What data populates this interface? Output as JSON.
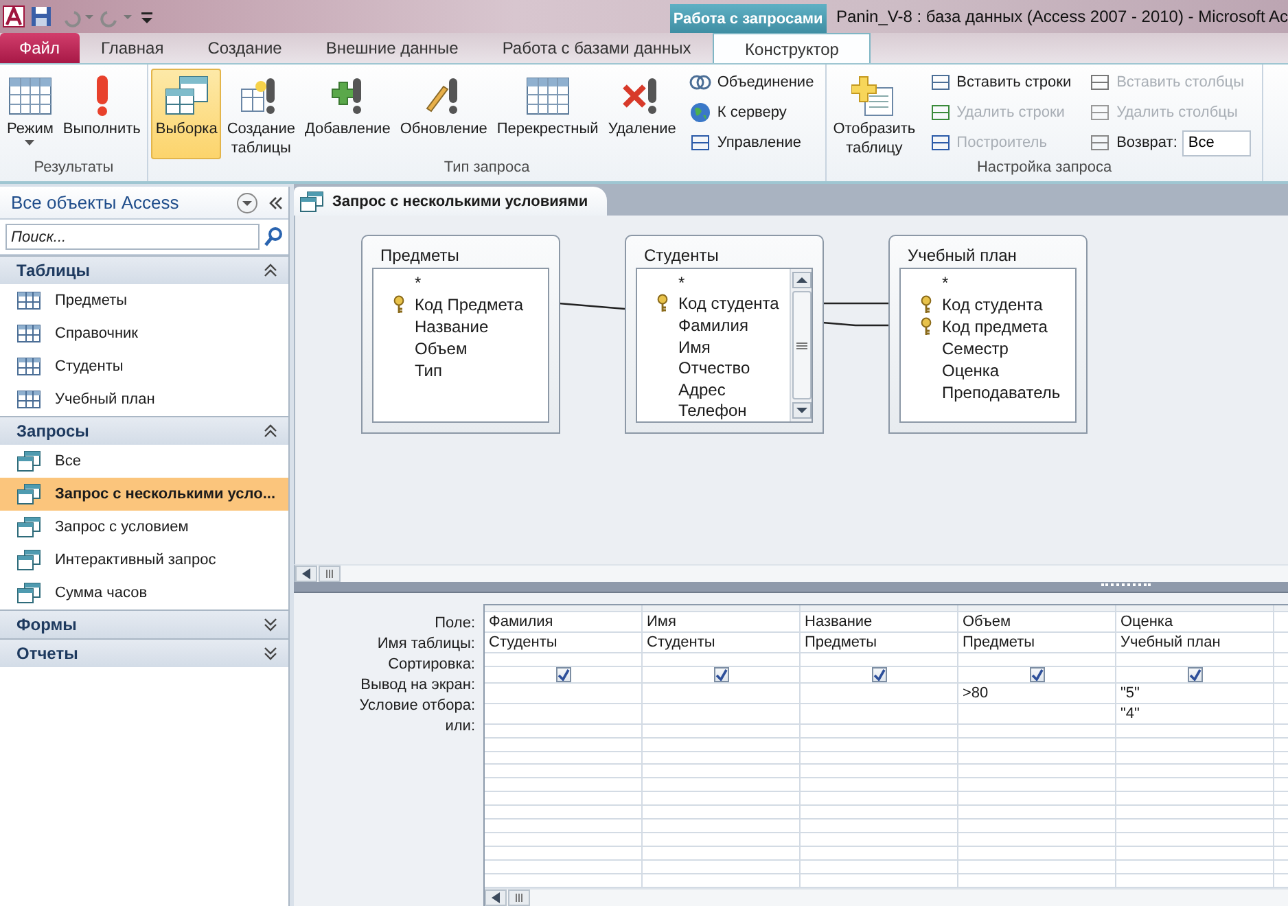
{
  "title_bar": {
    "context_group": "Работа с запросами",
    "title": "Panin_V-8 : база данных (Access 2007 - 2010)  -  Microsoft Ac"
  },
  "tabs": [
    {
      "label": "Файл",
      "kind": "file",
      "selected": false
    },
    {
      "label": "Главная",
      "kind": "normal",
      "selected": false
    },
    {
      "label": "Создание",
      "kind": "normal",
      "selected": false
    },
    {
      "label": "Внешние данные",
      "kind": "normal",
      "selected": false
    },
    {
      "label": "Работа с базами данных",
      "kind": "normal",
      "selected": false
    },
    {
      "label": "Конструктор",
      "kind": "context",
      "selected": true
    }
  ],
  "ribbon": {
    "groups": [
      {
        "label": "Результаты",
        "large_buttons": [
          {
            "label": "Режим",
            "dropdown": true,
            "selected": false
          },
          {
            "label": "Выполнить",
            "dropdown": false,
            "selected": false
          }
        ]
      },
      {
        "label": "Тип запроса",
        "large_buttons": [
          {
            "label": "Выборка",
            "dropdown": false,
            "selected": true
          },
          {
            "label": "Создание таблицы",
            "dropdown": false,
            "selected": false
          },
          {
            "label": "Добавление",
            "dropdown": false,
            "selected": false
          },
          {
            "label": "Обновление",
            "dropdown": false,
            "selected": false
          },
          {
            "label": "Перекрестный",
            "dropdown": false,
            "selected": false
          },
          {
            "label": "Удаление",
            "dropdown": false,
            "selected": false
          }
        ],
        "small_columns": [
          [
            {
              "kind": "button",
              "label": "Объединение",
              "disabled": false
            },
            {
              "kind": "button",
              "label": "К серверу",
              "disabled": false
            },
            {
              "kind": "button",
              "label": "Управление",
              "disabled": false
            }
          ]
        ]
      },
      {
        "label": "Настройка запроса",
        "large_buttons": [
          {
            "label": "Отобразить таблицу",
            "dropdown": false,
            "selected": false
          }
        ],
        "small_columns": [
          [
            {
              "kind": "button",
              "label": "Вставить строки",
              "disabled": false
            },
            {
              "kind": "button",
              "label": "Удалить строки",
              "disabled": true
            },
            {
              "kind": "button",
              "label": "Построитель",
              "disabled": true
            }
          ],
          [
            {
              "kind": "button",
              "label": "Вставить столбцы",
              "disabled": true
            },
            {
              "kind": "button",
              "label": "Удалить столбцы",
              "disabled": true
            },
            {
              "kind": "field",
              "label": "Возврат:",
              "value": "Все",
              "disabled": false
            }
          ]
        ]
      }
    ]
  },
  "sidebar": {
    "title": "Все объекты Access",
    "search": {
      "placeholder": "Поиск..."
    },
    "groups": [
      {
        "label": "Таблицы",
        "kind": "table",
        "expanded": true,
        "items": [
          {
            "label": "Предметы",
            "selected": false
          },
          {
            "label": "Справочник",
            "selected": false
          },
          {
            "label": "Студенты",
            "selected": false
          },
          {
            "label": "Учебный план",
            "selected": false
          }
        ]
      },
      {
        "label": "Запросы",
        "kind": "query",
        "expanded": true,
        "items": [
          {
            "label": "Все",
            "selected": false
          },
          {
            "label": "Запрос с несколькими усло...",
            "selected": true
          },
          {
            "label": "Запрос с условием",
            "selected": false
          },
          {
            "label": "Интерактивный запрос",
            "selected": false
          },
          {
            "label": "Сумма часов",
            "selected": false
          }
        ]
      },
      {
        "label": "Формы",
        "expanded": false
      },
      {
        "label": "Отчеты",
        "expanded": false
      }
    ]
  },
  "document_tab": {
    "label": "Запрос с несколькими условиями"
  },
  "tables": [
    {
      "title": "Предметы",
      "has_scrollbar": false,
      "fields": [
        {
          "name": "*",
          "primary_key": false
        },
        {
          "name": "Код Предмета",
          "primary_key": true
        },
        {
          "name": "Название",
          "primary_key": false
        },
        {
          "name": "Объем",
          "primary_key": false
        },
        {
          "name": "Тип",
          "primary_key": false
        }
      ]
    },
    {
      "title": "Студенты",
      "has_scrollbar": true,
      "fields": [
        {
          "name": "*",
          "primary_key": false
        },
        {
          "name": "Код студента",
          "primary_key": true
        },
        {
          "name": "Фамилия",
          "primary_key": false
        },
        {
          "name": "Имя",
          "primary_key": false
        },
        {
          "name": "Отчество",
          "primary_key": false
        },
        {
          "name": "Адрес",
          "primary_key": false
        },
        {
          "name": "Телефон",
          "primary_key": false
        }
      ]
    },
    {
      "title": "Учебный план",
      "has_scrollbar": false,
      "fields": [
        {
          "name": "*",
          "primary_key": false
        },
        {
          "name": "Код студента",
          "primary_key": true
        },
        {
          "name": "Код предмета",
          "primary_key": true
        },
        {
          "name": "Семестр",
          "primary_key": false
        },
        {
          "name": "Оценка",
          "primary_key": false
        },
        {
          "name": "Преподаватель",
          "primary_key": false
        }
      ]
    }
  ],
  "grid": {
    "row_labels": [
      "Поле:",
      "Имя таблицы:",
      "Сортировка:",
      "Вывод на экран:",
      "Условие отбора:",
      "или:"
    ],
    "columns": [
      {
        "field": "Фамилия",
        "table": "Студенты",
        "show": true
      },
      {
        "field": "Имя",
        "table": "Студенты",
        "show": true
      },
      {
        "field": "Название",
        "table": "Предметы",
        "show": true
      },
      {
        "field": "Объем",
        "table": "Предметы",
        "show": true,
        "criteria": ">80"
      },
      {
        "field": "Оценка",
        "table": "Учебный план",
        "show": true,
        "criteria": "\"5\"",
        "or": "\"4\""
      }
    ]
  }
}
